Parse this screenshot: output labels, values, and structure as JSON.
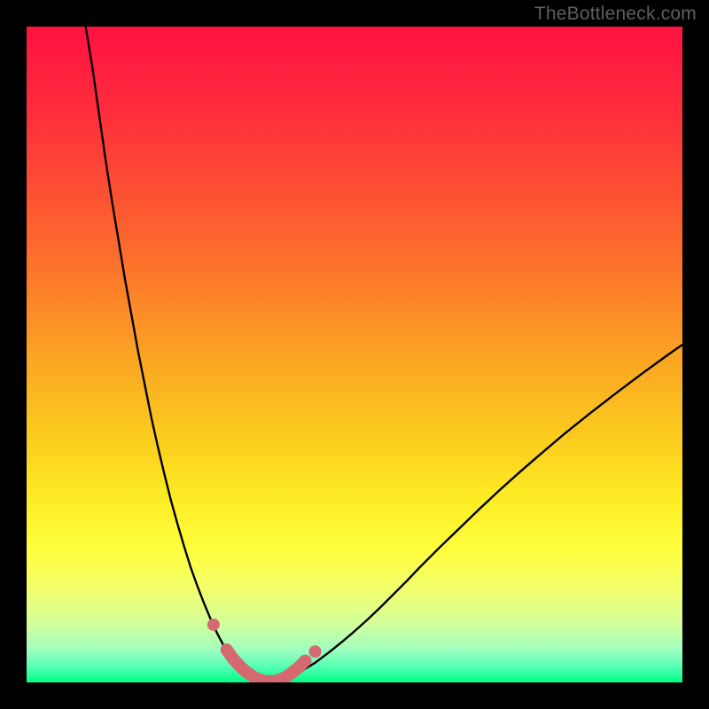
{
  "watermark": "TheBottleneck.com",
  "colors": {
    "page_bg": "#000000",
    "gradient_stops": [
      {
        "offset": 0.0,
        "color": "#fe1241"
      },
      {
        "offset": 0.12,
        "color": "#fe2b3c"
      },
      {
        "offset": 0.25,
        "color": "#fd4f33"
      },
      {
        "offset": 0.38,
        "color": "#fc782a"
      },
      {
        "offset": 0.5,
        "color": "#fba323"
      },
      {
        "offset": 0.62,
        "color": "#fbca1e"
      },
      {
        "offset": 0.72,
        "color": "#fcec24"
      },
      {
        "offset": 0.8,
        "color": "#feff3f"
      },
      {
        "offset": 0.86,
        "color": "#f2ff6e"
      },
      {
        "offset": 0.91,
        "color": "#d3ff9a"
      },
      {
        "offset": 0.95,
        "color": "#a0ffc0"
      },
      {
        "offset": 0.975,
        "color": "#59ffb5"
      },
      {
        "offset": 1.0,
        "color": "#00ff88"
      }
    ],
    "curve": "#000000",
    "highlight_stroke": "#d46a6f",
    "highlight_dot": "#d46a6f"
  },
  "chart_data": {
    "type": "line",
    "title": "",
    "xlabel": "",
    "ylabel": "",
    "xlim": [
      0,
      100
    ],
    "ylim": [
      0,
      100
    ],
    "x": [
      9.0,
      10.0,
      11.0,
      12.0,
      13.0,
      14.0,
      15.0,
      16.0,
      17.0,
      18.0,
      19.0,
      20.0,
      21.0,
      22.0,
      23.0,
      24.0,
      25.0,
      26.0,
      27.0,
      28.0,
      29.0,
      30.0,
      31.0,
      32.0,
      33.0,
      34.0,
      35.0,
      36.0,
      38.0,
      40.0,
      42.0,
      44.0,
      46.0,
      48.0,
      50.0,
      52.0,
      54.0,
      56.0,
      58.0,
      60.0,
      63.0,
      66.0,
      69.0,
      72.0,
      75.0,
      78.0,
      82.0,
      86.0,
      90.0,
      94.0,
      98.0,
      100.0
    ],
    "values": [
      100.0,
      94.0,
      87.0,
      80.0,
      73.5,
      67.5,
      61.5,
      56.0,
      50.5,
      45.5,
      40.5,
      36.0,
      31.8,
      27.8,
      24.2,
      20.8,
      17.6,
      14.8,
      12.2,
      9.8,
      7.6,
      5.7,
      4.1,
      2.8,
      1.8,
      1.1,
      0.55,
      0.2,
      0.15,
      0.7,
      1.8,
      3.0,
      4.5,
      6.1,
      7.8,
      9.6,
      11.5,
      13.5,
      15.5,
      17.6,
      20.6,
      23.5,
      26.4,
      29.2,
      31.9,
      34.5,
      37.9,
      41.1,
      44.2,
      47.2,
      50.1,
      51.5
    ],
    "highlight_segment": {
      "x": [
        30.5,
        31.5,
        32.5,
        33.5,
        34.5,
        35.5,
        36.5,
        37.5,
        38.5,
        39.5,
        40.5,
        41.5,
        42.5
      ],
      "values": [
        5.0,
        3.6,
        2.5,
        1.6,
        0.9,
        0.4,
        0.18,
        0.15,
        0.35,
        0.8,
        1.5,
        2.3,
        3.3
      ]
    },
    "highlight_dots": {
      "x": [
        28.5,
        44.0
      ],
      "values": [
        8.8,
        4.7
      ]
    },
    "notch_x": 36.8
  }
}
